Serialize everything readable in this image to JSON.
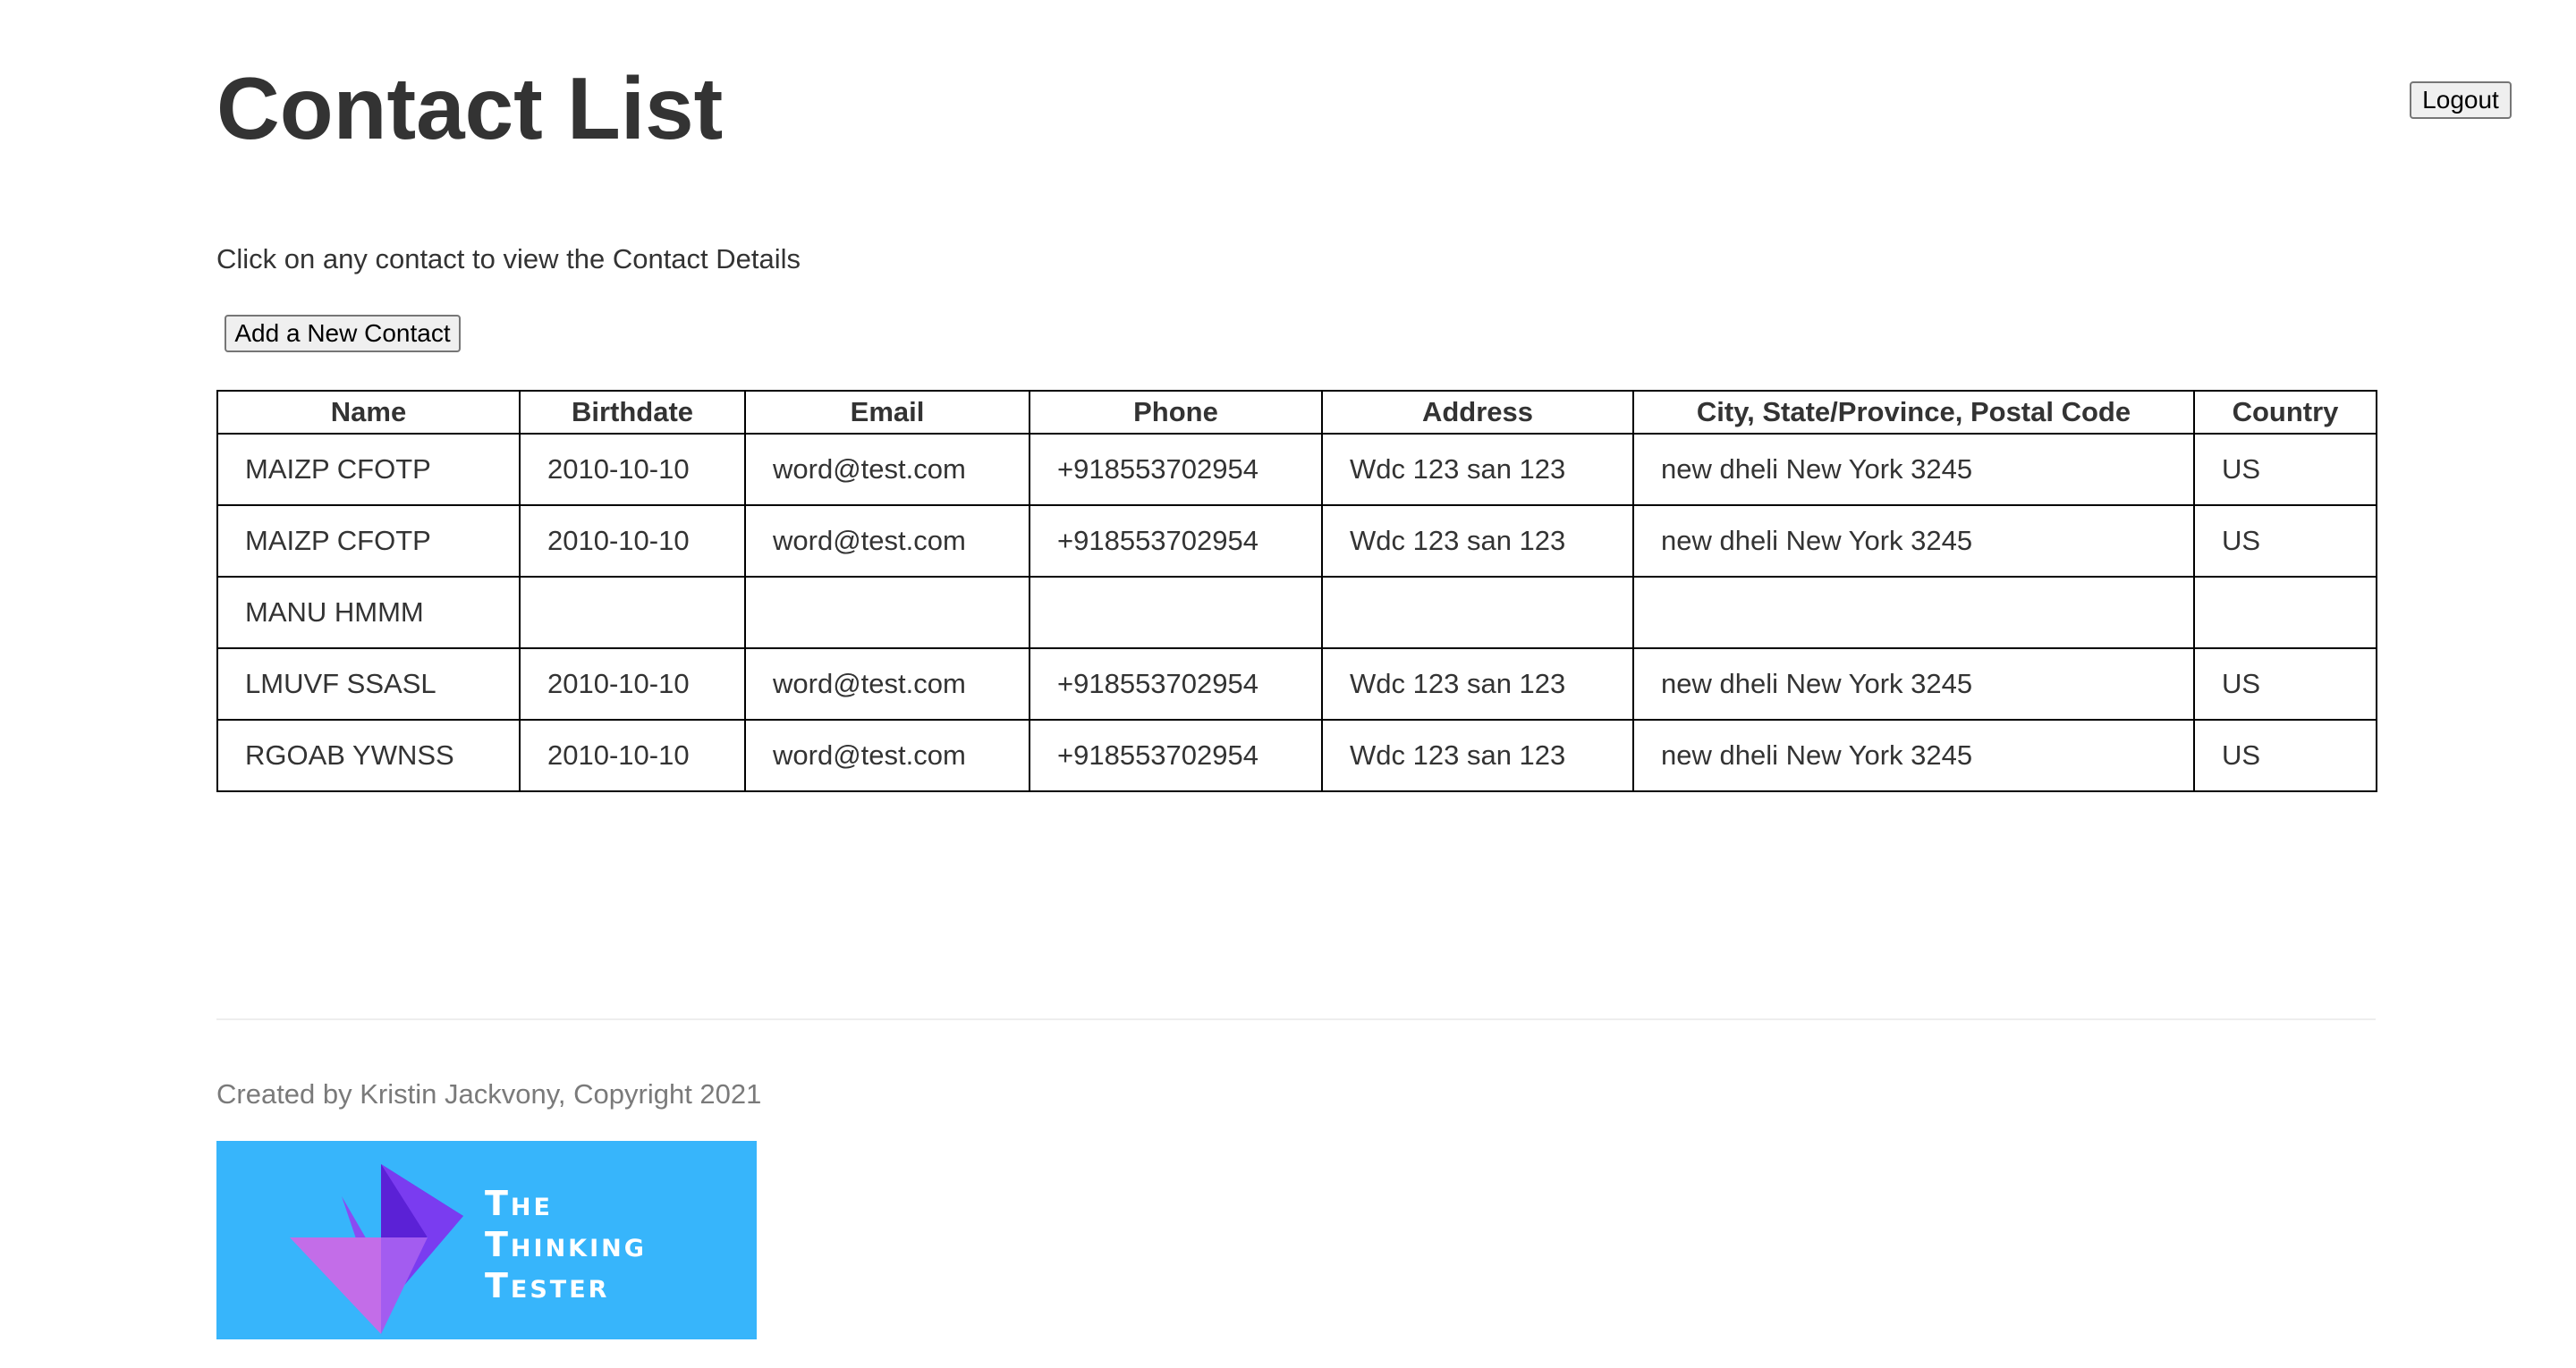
{
  "header": {
    "title": "Contact List",
    "logout_label": "Logout"
  },
  "main": {
    "instructions": "Click on any contact to view the Contact Details",
    "add_contact_label": "Add a New Contact",
    "table": {
      "columns": [
        "Name",
        "Birthdate",
        "Email",
        "Phone",
        "Address",
        "City, State/Province, Postal Code",
        "Country"
      ],
      "rows": [
        {
          "name": "MAIZP CFOTP",
          "birthdate": "2010-10-10",
          "email": "word@test.com",
          "phone": "+918553702954",
          "address": "Wdc 123 san 123",
          "city_state_postal": "new dheli New York 3245",
          "country": "US"
        },
        {
          "name": "MAIZP CFOTP",
          "birthdate": "2010-10-10",
          "email": "word@test.com",
          "phone": "+918553702954",
          "address": "Wdc 123 san 123",
          "city_state_postal": "new dheli New York 3245",
          "country": "US"
        },
        {
          "name": "MANU HMMM",
          "birthdate": "",
          "email": "",
          "phone": "",
          "address": "",
          "city_state_postal": "",
          "country": ""
        },
        {
          "name": "LMUVF SSASL",
          "birthdate": "2010-10-10",
          "email": "word@test.com",
          "phone": "+918553702954",
          "address": "Wdc 123 san 123",
          "city_state_postal": "new dheli New York 3245",
          "country": "US"
        },
        {
          "name": "RGOAB YWNSS",
          "birthdate": "2010-10-10",
          "email": "word@test.com",
          "phone": "+918553702954",
          "address": "Wdc 123 san 123",
          "city_state_postal": "new dheli New York 3245",
          "country": "US"
        }
      ]
    }
  },
  "footer": {
    "credit": "Created by Kristin Jackvony, Copyright 2021",
    "logo": {
      "lines": [
        "The",
        "Thinking",
        "Tester"
      ],
      "background_color": "#37b5fb",
      "icon": "origami-bird-icon"
    }
  }
}
